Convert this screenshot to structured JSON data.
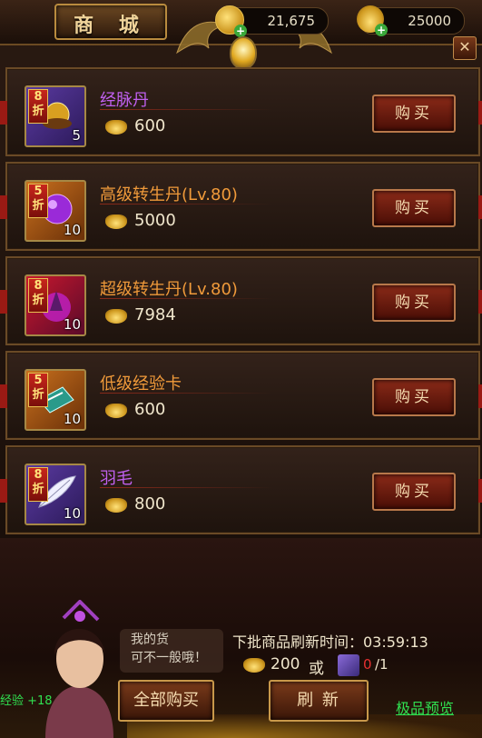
{
  "header": {
    "title": "商 城",
    "coins_value": "21,675",
    "ingots_value": "25000",
    "close_symbol": "✕"
  },
  "items": [
    {
      "discount": "8\n折",
      "qty": "5",
      "name": "经脉丹",
      "price": "600",
      "buy_label": "购买",
      "rarity": "purple"
    },
    {
      "discount": "5\n折",
      "qty": "10",
      "name": "高级转生丹(Lv.80)",
      "price": "5000",
      "buy_label": "购买",
      "rarity": "orange"
    },
    {
      "discount": "8\n折",
      "qty": "10",
      "name": "超级转生丹(Lv.80)",
      "price": "7984",
      "buy_label": "购买",
      "rarity": "orange"
    },
    {
      "discount": "5\n折",
      "qty": "10",
      "name": "低级经验卡",
      "price": "600",
      "buy_label": "购买",
      "rarity": "orange"
    },
    {
      "discount": "8\n折",
      "qty": "10",
      "name": "羽毛",
      "price": "800",
      "buy_label": "购买",
      "rarity": "purple"
    }
  ],
  "footer": {
    "bubble_line1": "我的货",
    "bubble_line2": "可不一般哦！",
    "exp_text": "经验 +18",
    "refresh_time": "下批商品刷新时间：03:59:13",
    "refresh_cost": "200",
    "or_text": "或",
    "key_count": "0",
    "key_total": "/1",
    "buy_all_label": "全部购买",
    "refresh_label": "刷  新",
    "preview_label": "极品预览"
  },
  "colors": {
    "purple_name": "#c060f0",
    "orange_name": "#f09a3a",
    "green_text": "#30e050"
  }
}
